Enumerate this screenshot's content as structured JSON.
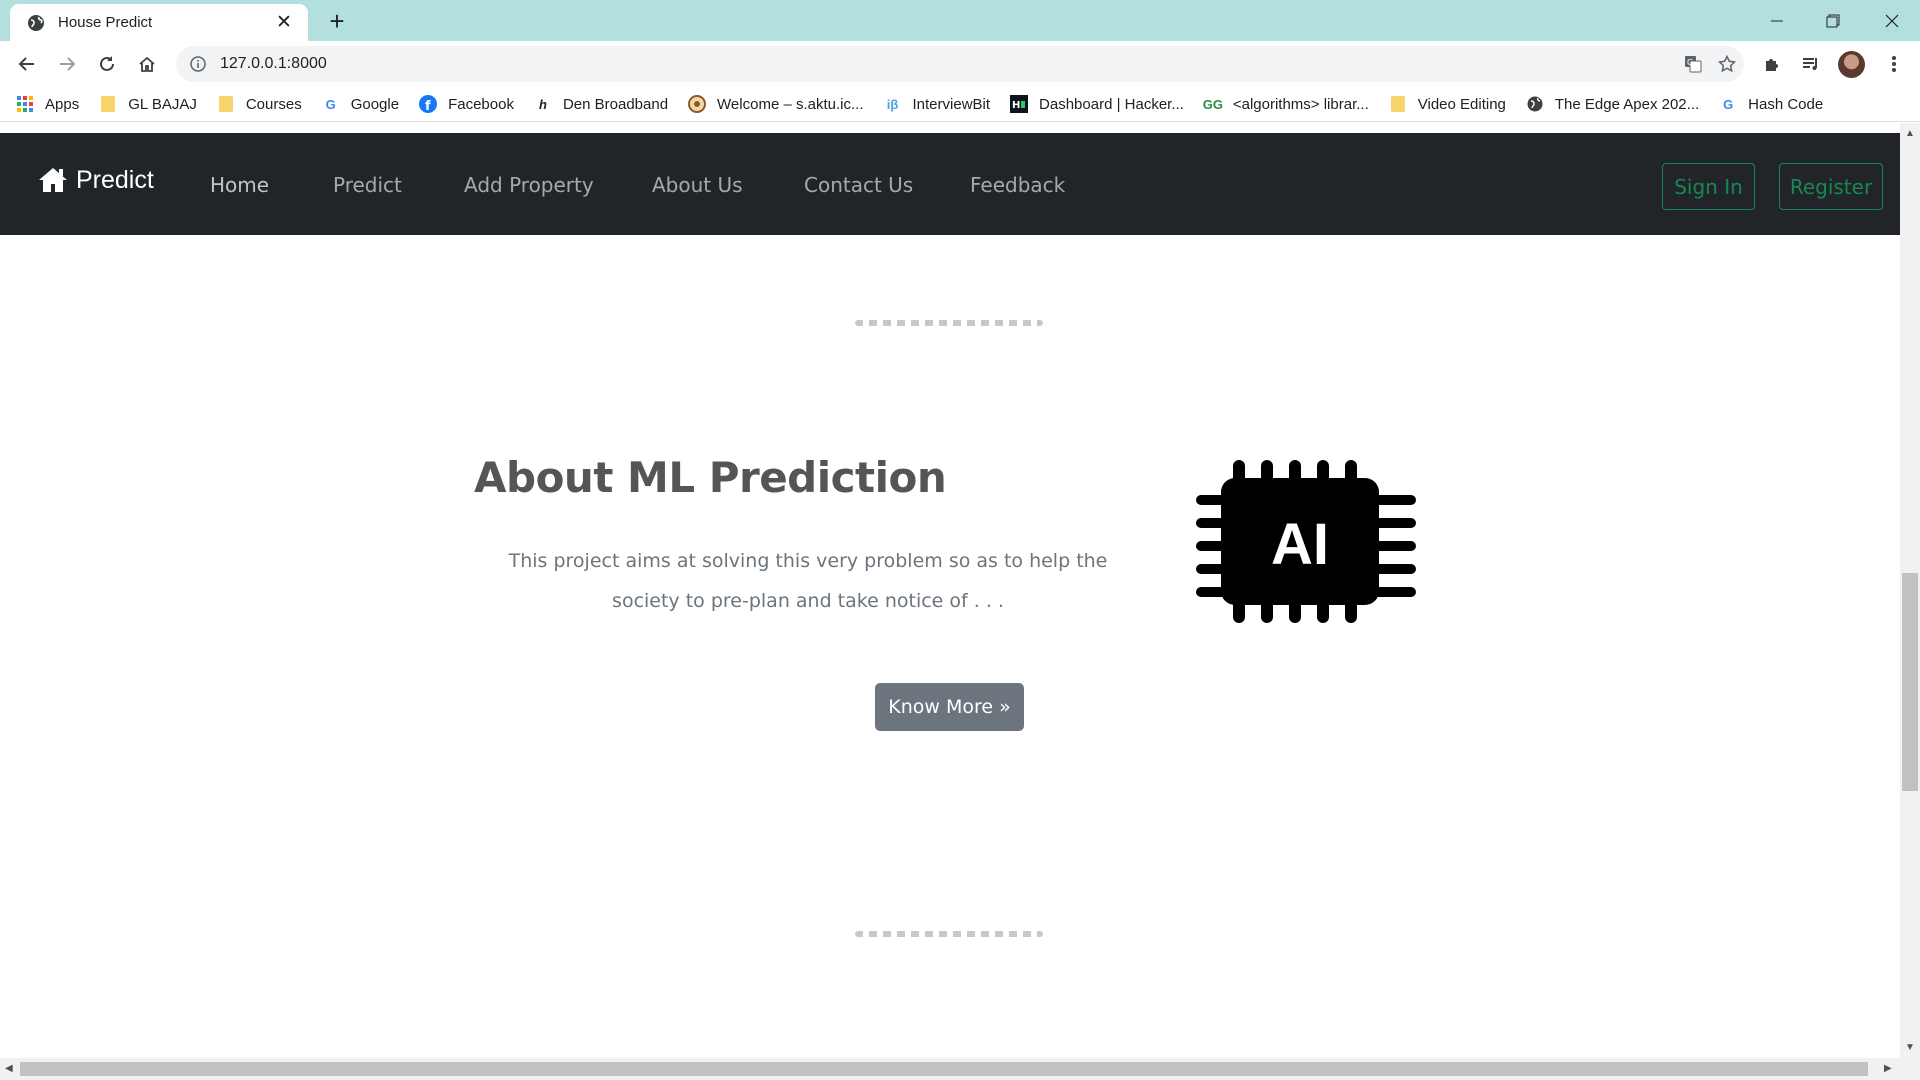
{
  "browser": {
    "tab_title": "House Predict",
    "url": "127.0.0.1:8000",
    "bookmarks": [
      {
        "label": "Apps",
        "icon": "apps-grid-icon"
      },
      {
        "label": "GL BAJAJ",
        "icon": "folder-icon"
      },
      {
        "label": "Courses",
        "icon": "folder-icon"
      },
      {
        "label": "Google",
        "icon": "google-icon"
      },
      {
        "label": "Facebook",
        "icon": "facebook-icon"
      },
      {
        "label": "Den Broadband",
        "icon": "den-icon"
      },
      {
        "label": "Welcome – s.aktu.ic...",
        "icon": "aktu-icon"
      },
      {
        "label": "InterviewBit",
        "icon": "interviewbit-icon"
      },
      {
        "label": "Dashboard | Hacker...",
        "icon": "hackerrank-icon"
      },
      {
        "label": "<algorithms> librar...",
        "icon": "geeksforgeeks-icon"
      },
      {
        "label": "Video Editing",
        "icon": "folder-icon"
      },
      {
        "label": "The Edge Apex 202...",
        "icon": "globe-icon"
      },
      {
        "label": "Hash Code",
        "icon": "google-icon"
      }
    ]
  },
  "navbar": {
    "brand": "Predict",
    "links": {
      "home": "Home",
      "predict": "Predict",
      "add_property": "Add Property",
      "about_us": "About Us",
      "contact_us": "Contact Us",
      "feedback": "Feedback"
    },
    "sign_in": "Sign In",
    "register": "Register"
  },
  "section": {
    "title": "About ML Prediction",
    "text": "This project aims at solving this very problem so as to help the society to pre-plan and take notice of . . .",
    "button": "Know More »",
    "chip_label": "AI"
  },
  "colors": {
    "navbar_bg": "#212529",
    "outline_success": "#198754",
    "button_secondary": "#6c757d",
    "tabstrip_bg": "#b3dfdf"
  }
}
